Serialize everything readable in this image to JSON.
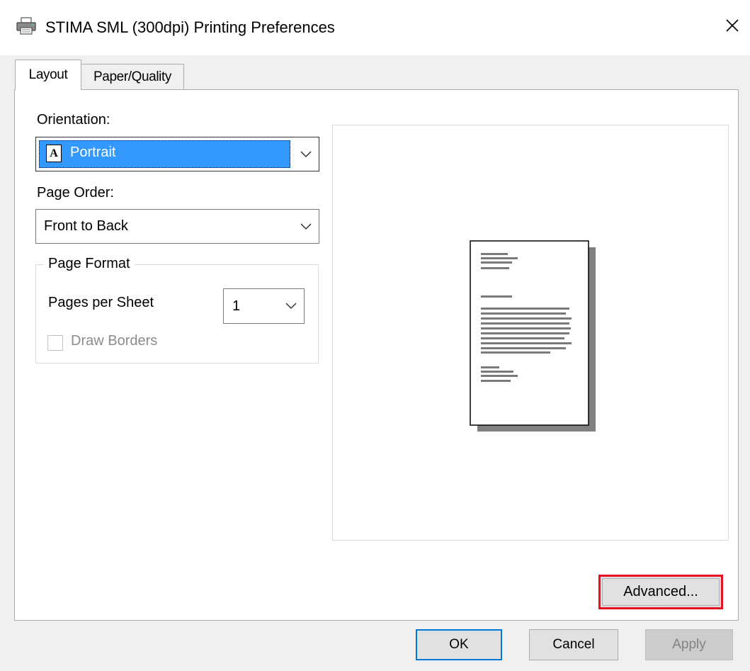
{
  "window": {
    "title": "STIMA SML (300dpi) Printing Preferences",
    "icon": "printer-icon",
    "close_glyph": "✕"
  },
  "tabs": [
    {
      "label": "Layout",
      "selected": true
    },
    {
      "label": "Paper/Quality",
      "selected": false
    }
  ],
  "orientation": {
    "label": "Orientation:",
    "value": "Portrait",
    "icon_glyph": "A"
  },
  "page_order": {
    "label": "Page Order:",
    "value": "Front to Back"
  },
  "page_format": {
    "legend": "Page Format",
    "pages_per_sheet_label": "Pages per Sheet",
    "pages_per_sheet_value": "1",
    "draw_borders_label": "Draw Borders",
    "draw_borders_checked": false,
    "draw_borders_enabled": false
  },
  "buttons": {
    "advanced": "Advanced...",
    "ok": "OK",
    "cancel": "Cancel",
    "apply": "Apply"
  },
  "colors": {
    "selection": "#3399ff",
    "highlight_border": "#e81123",
    "default_button_border": "#0078d7"
  }
}
